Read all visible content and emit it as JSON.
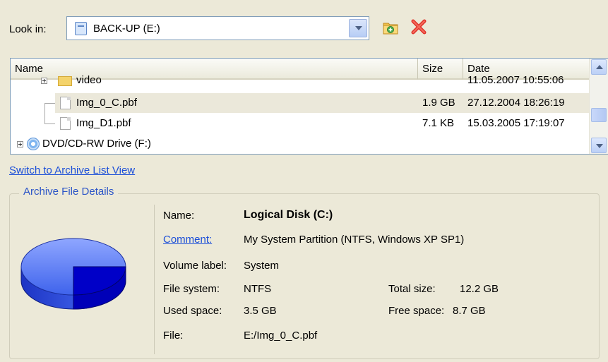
{
  "look_in": {
    "label": "Look in:",
    "value": "BACK-UP (E:)"
  },
  "toolbar": {
    "new_folder_icon": "new-folder-icon",
    "delete_icon": "delete-icon"
  },
  "file_list": {
    "columns": {
      "name": "Name",
      "size": "Size",
      "date": "Date"
    },
    "rows": [
      {
        "name": "video",
        "size": "",
        "date": "11.05.2007 10:55:06",
        "type": "folder"
      },
      {
        "name": "Img_0_C.pbf",
        "size": "1.9 GB",
        "date": "27.12.2004 18:26:19",
        "type": "file",
        "selected": true
      },
      {
        "name": "Img_D1.pbf",
        "size": "7.1 KB",
        "date": "15.03.2005 17:19:07",
        "type": "file"
      },
      {
        "name": "DVD/CD-RW Drive (F:)",
        "size": "",
        "date": "",
        "type": "dvd-drive"
      }
    ]
  },
  "switch_link": "Switch to Archive List View",
  "details": {
    "legend": "Archive File Details",
    "name_label": "Name:",
    "name_value": "Logical Disk (C:)",
    "comment_label": "Comment:",
    "comment_value": "My System Partition (NTFS, Windows XP SP1)",
    "volume_label_label": "Volume label:",
    "volume_label_value": "System",
    "file_system_label": "File system:",
    "file_system_value": "NTFS",
    "total_size_label": "Total size:",
    "total_size_value": "12.2 GB",
    "used_space_label": "Used space:",
    "used_space_value": "3.5 GB",
    "free_space_label": "Free space:",
    "free_space_value": "8.7 GB",
    "file_label": "File:",
    "file_value": "E:/Img_0_C.pbf"
  },
  "colors": {
    "used": "#0000c8",
    "free": "#4a6cf0",
    "link": "#1c4fd8"
  }
}
